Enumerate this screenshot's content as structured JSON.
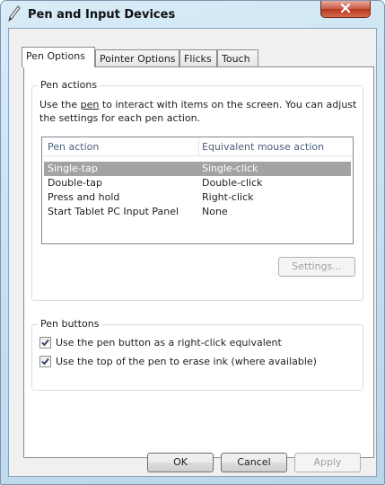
{
  "window": {
    "title": "Pen and Input Devices"
  },
  "tabs": [
    {
      "label": "Pen Options",
      "active": true
    },
    {
      "label": "Pointer Options",
      "active": false
    },
    {
      "label": "Flicks",
      "active": false
    },
    {
      "label": "Touch",
      "active": false
    }
  ],
  "pen_actions": {
    "legend": "Pen actions",
    "description_line1_pre": "Use the ",
    "description_line1_link": "pen",
    "description_line1_post": " to interact with items on the screen.  You can adjust",
    "description_line2": "the settings for each pen action.",
    "columns": [
      "Pen action",
      "Equivalent mouse action"
    ],
    "rows": [
      {
        "action": "Single-tap",
        "mouse": "Single-click",
        "selected": true
      },
      {
        "action": "Double-tap",
        "mouse": "Double-click",
        "selected": false
      },
      {
        "action": "Press and hold",
        "mouse": "Right-click",
        "selected": false
      },
      {
        "action": "Start Tablet PC Input Panel",
        "mouse": "None",
        "selected": false
      }
    ],
    "settings_button": "Settings..."
  },
  "pen_buttons": {
    "legend": "Pen buttons",
    "options": [
      {
        "label": "Use the pen button as a right-click equivalent",
        "checked": true
      },
      {
        "label": "Use the top of the pen to erase ink (where available)",
        "checked": true
      }
    ]
  },
  "footer": {
    "ok": "OK",
    "cancel": "Cancel",
    "apply": "Apply"
  }
}
